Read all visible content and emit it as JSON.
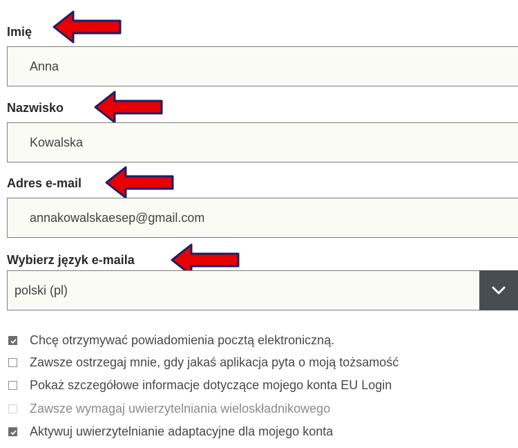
{
  "form": {
    "first_name": {
      "label": "Imię",
      "value": "Anna"
    },
    "last_name": {
      "label": "Nazwisko",
      "value": "Kowalska"
    },
    "email": {
      "label": "Adres e-mail",
      "value": "annakowalskaesep@gmail.com"
    },
    "language": {
      "label": "Wybierz język e-maila",
      "selected": "polski (pl)"
    }
  },
  "options": [
    {
      "label": "Chcę otrzymywać powiadomienia pocztą elektroniczną.",
      "checked": true,
      "disabled": false
    },
    {
      "label": "Zawsze ostrzegaj mnie, gdy jakaś aplikacja pyta o moją tożsamość",
      "checked": false,
      "disabled": false
    },
    {
      "label": "Pokaż szczegółowe informacje dotyczące mojego konta EU Login",
      "checked": false,
      "disabled": false
    },
    {
      "label": "Zawsze wymagaj uwierzytelniania wieloskładnikowego",
      "checked": false,
      "disabled": true
    },
    {
      "label": "Aktywuj uwierzytelnianie adaptacyjne dla mojego konta",
      "checked": true,
      "disabled": false
    }
  ],
  "colors": {
    "annotation_arrow_fill": "#e60000",
    "annotation_arrow_outline": "#1a1f6b",
    "select_button": "#484d52",
    "field_background": "#fbfbf5"
  },
  "icons": {
    "annotation": "arrow-left-icon",
    "select": "chevron-down-icon",
    "checkbox_checked": "checkmark-icon"
  }
}
